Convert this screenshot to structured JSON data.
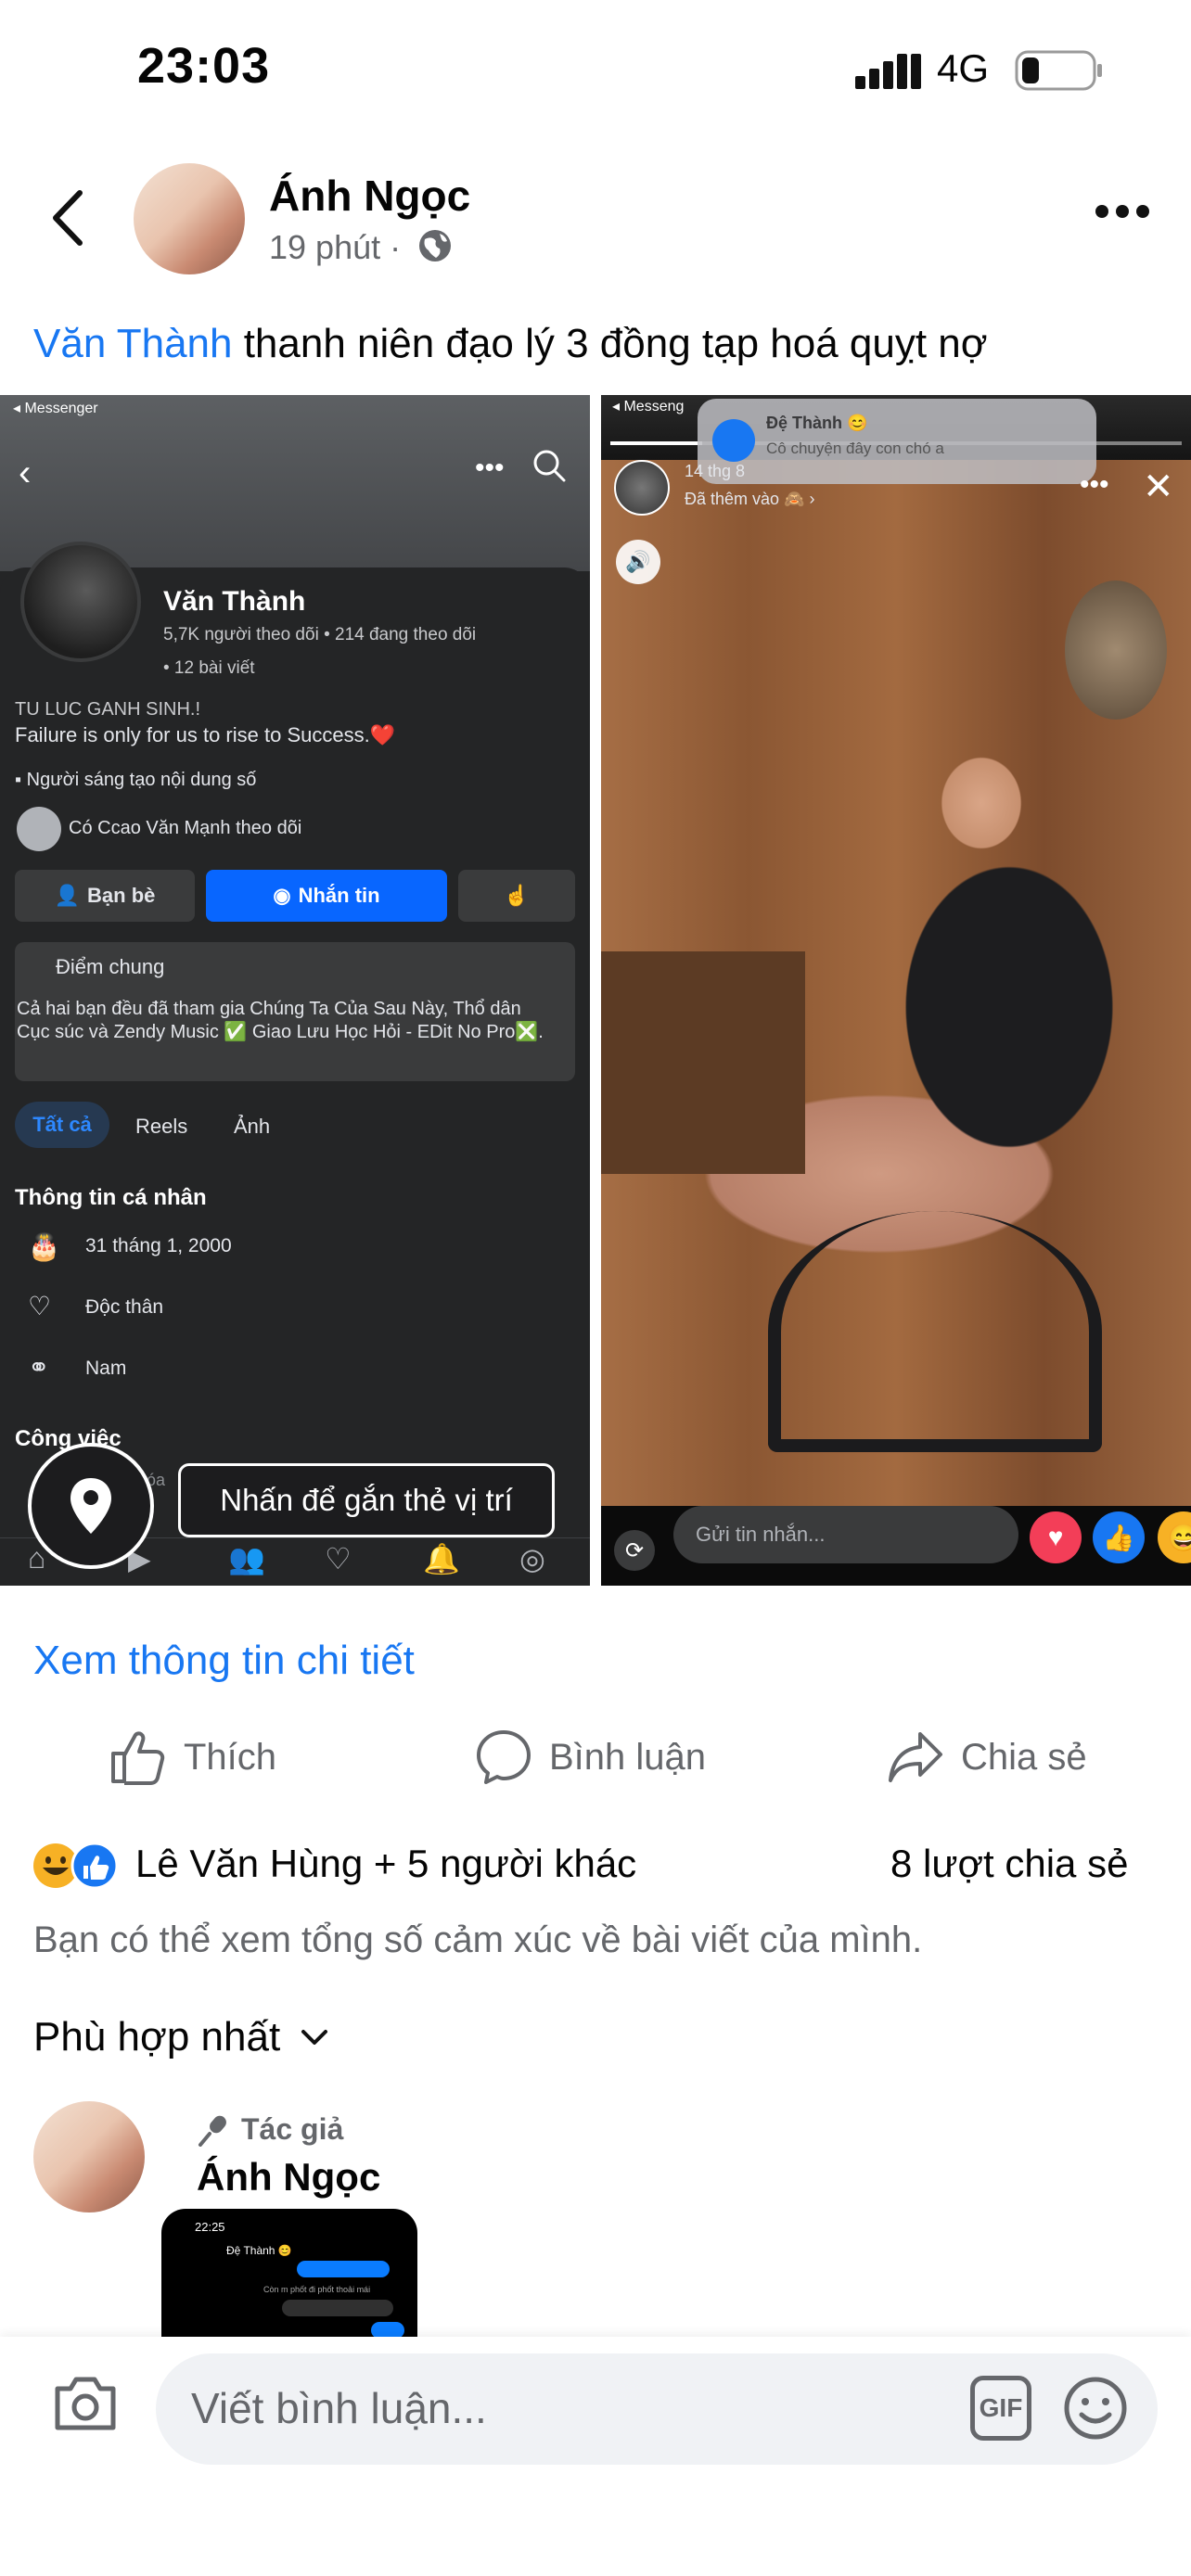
{
  "status_bar": {
    "time": "23:03",
    "network": "4G"
  },
  "post": {
    "author": "Ánh Ngọc",
    "time": "19 phút ·",
    "caption_mention": "Văn Thành",
    "caption_text": " thanh niên đạo lý 3 đồng tạp hoá quỵt nợ"
  },
  "left_screenshot": {
    "messenger_label": "◂ Messenger",
    "name": "Văn Thành",
    "stats": "5,7K người theo dõi • 214 đang theo dõi",
    "posts": "• 12 bài viết",
    "bio_line1": "TU LUC GANH SINH.!",
    "bio_line2": "Failure is only for us to rise to Success.❤️",
    "creator": "Người sáng tạo nội dung số",
    "followed_by": "Có Ccao Văn Mạnh theo dõi",
    "btn_friends": "Bạn bè",
    "btn_message": "Nhắn tin",
    "mutual_title": "Điểm chung",
    "mutual_text": "Cả hai bạn đều đã tham gia Chúng Ta Của Sau Này, Thổ dân Cục súc và Zendy Music ✅ Giao Lưu Học Hỏi - EDit No Pro❎.",
    "tab_all": "Tất cả",
    "tab_reels": "Reels",
    "tab_photos": "Ảnh",
    "info_title": "Thông tin cá nhân",
    "info_birthday": "31 tháng 1, 2000",
    "info_relationship": "Độc thân",
    "info_gender": "Nam",
    "work_title": "Công việc",
    "work_sub": "anh Hóa"
  },
  "location_tag": {
    "tooltip": "Nhấn để gắn thẻ vị trí"
  },
  "right_screenshot": {
    "messenger_label": "◂ Messeng",
    "notif_name": "Đệ Thành 😊",
    "notif_text": "Cô chuyện đây con chó a",
    "story_date": "14 thg 8",
    "story_added": "Đã thêm vào 🙈 ›",
    "message_placeholder": "Gửi tin nhắn...",
    "progress": 0.16
  },
  "actions": {
    "see_detail": "Xem thông tin chi tiết",
    "like": "Thích",
    "comment": "Bình luận",
    "share": "Chia sẻ"
  },
  "reactions": {
    "summary": "Lê Văn Hùng + 5 người khác",
    "shares": "8 lượt chia sẻ",
    "note": "Bạn có thể xem tổng số cảm xúc về bài viết của mình."
  },
  "comments": {
    "sort_label": "Phù hợp nhất",
    "first": {
      "role": "Tác giả",
      "author": "Ánh Ngọc",
      "img_time": "22:25",
      "img_name": "Đệ Thành 😊",
      "img_line": "Còn m phốt đi phốt thoải mái"
    }
  },
  "composer": {
    "placeholder": "Viết bình luận...",
    "gif": "GIF"
  },
  "colors": {
    "accent": "#1877f2",
    "secondary_text": "#65676b",
    "messenger_blue": "#0866ff"
  }
}
